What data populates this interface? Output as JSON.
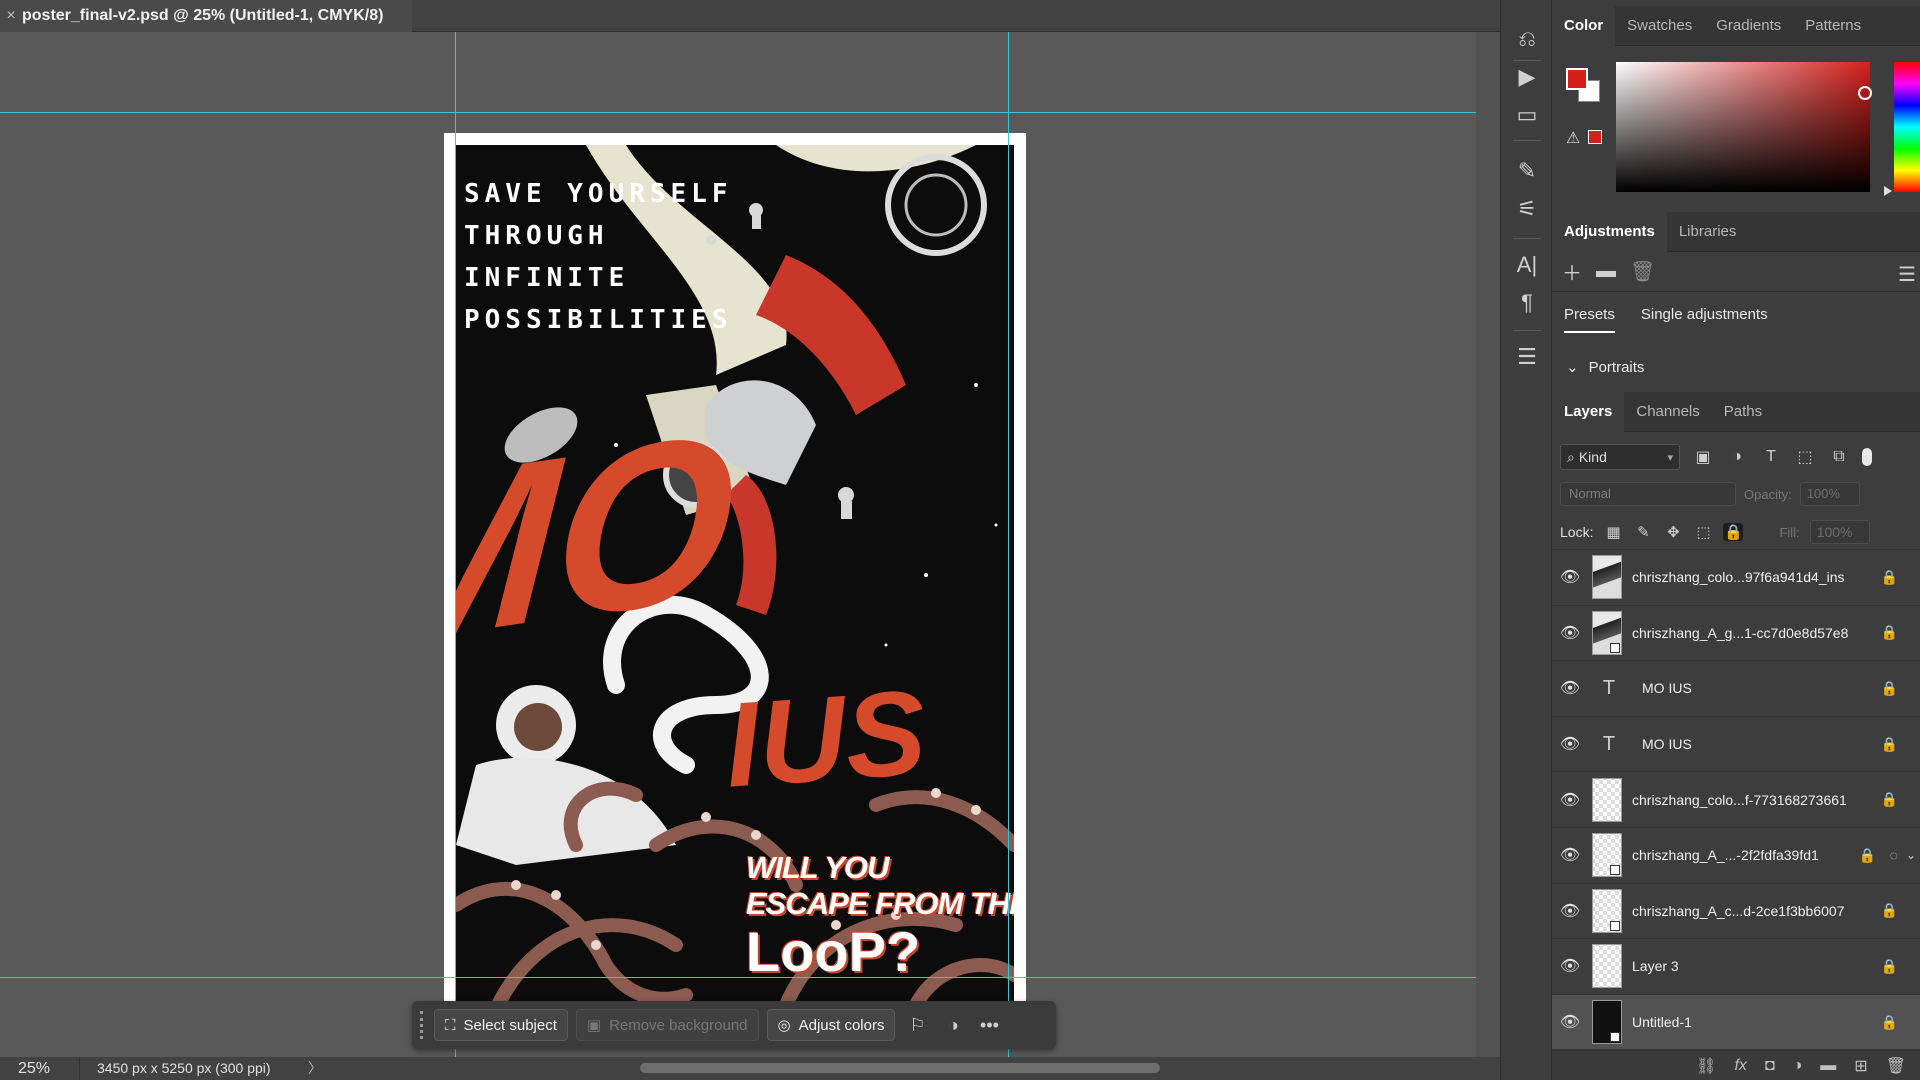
{
  "document": {
    "tab_title": "poster_final-v2.psd @ 25% (Untitled-1, CMYK/8)",
    "close_glyph": "×"
  },
  "poster": {
    "tagline": [
      "SAVE YOURSELF",
      "THROUGH",
      "INFINITE",
      "POSSIBILITIES"
    ],
    "title_parts": [
      "MO",
      "IUS"
    ],
    "question": [
      "WILL YOU",
      "ESCAPE FROM THE",
      "LooP?"
    ]
  },
  "taskbar": {
    "select_subject": "Select subject",
    "remove_background": "Remove background",
    "adjust_colors": "Adjust colors",
    "more_glyph": "•••"
  },
  "status": {
    "zoom": "25%",
    "dimensions": "3450 px x 5250 px (300 ppi)",
    "arrow": "〉"
  },
  "color_panel": {
    "tabs": [
      "Color",
      "Swatches",
      "Gradients",
      "Patterns"
    ],
    "active_tab": 0,
    "foreground": "#d4201b",
    "background": "#ffffff"
  },
  "adjustments_panel": {
    "tabs": [
      "Adjustments",
      "Libraries"
    ],
    "subtabs": [
      "Presets",
      "Single adjustments"
    ],
    "group": "Portraits"
  },
  "layers_panel": {
    "tabs": [
      "Layers",
      "Channels",
      "Paths"
    ],
    "kind_label": "Kind",
    "blend_mode": "Normal",
    "opacity_label": "Opacity:",
    "opacity_value": "100%",
    "lock_label": "Lock:",
    "fill_label": "Fill:",
    "fill_value": "100%",
    "layers": [
      {
        "name": "chriszhang_colo...97f6a941d4_ins",
        "kind": "image",
        "smart": false
      },
      {
        "name": "chriszhang_A_g...1-cc7d0e8d57e8",
        "kind": "image",
        "smart": true
      },
      {
        "name": "MO IUS",
        "kind": "type",
        "smart": false
      },
      {
        "name": "MO IUS",
        "kind": "type",
        "smart": false
      },
      {
        "name": "chriszhang_colo...f-773168273661",
        "kind": "transparent",
        "smart": false
      },
      {
        "name": "chriszhang_A_...-2f2fdfa39fd1",
        "kind": "transparent",
        "smart": true
      },
      {
        "name": "chriszhang_A_c...d-2ce1f3bb6007",
        "kind": "transparent",
        "smart": true
      },
      {
        "name": "Layer 3",
        "kind": "transparent",
        "smart": false
      },
      {
        "name": "Untitled-1",
        "kind": "dark",
        "smart": true
      }
    ]
  }
}
